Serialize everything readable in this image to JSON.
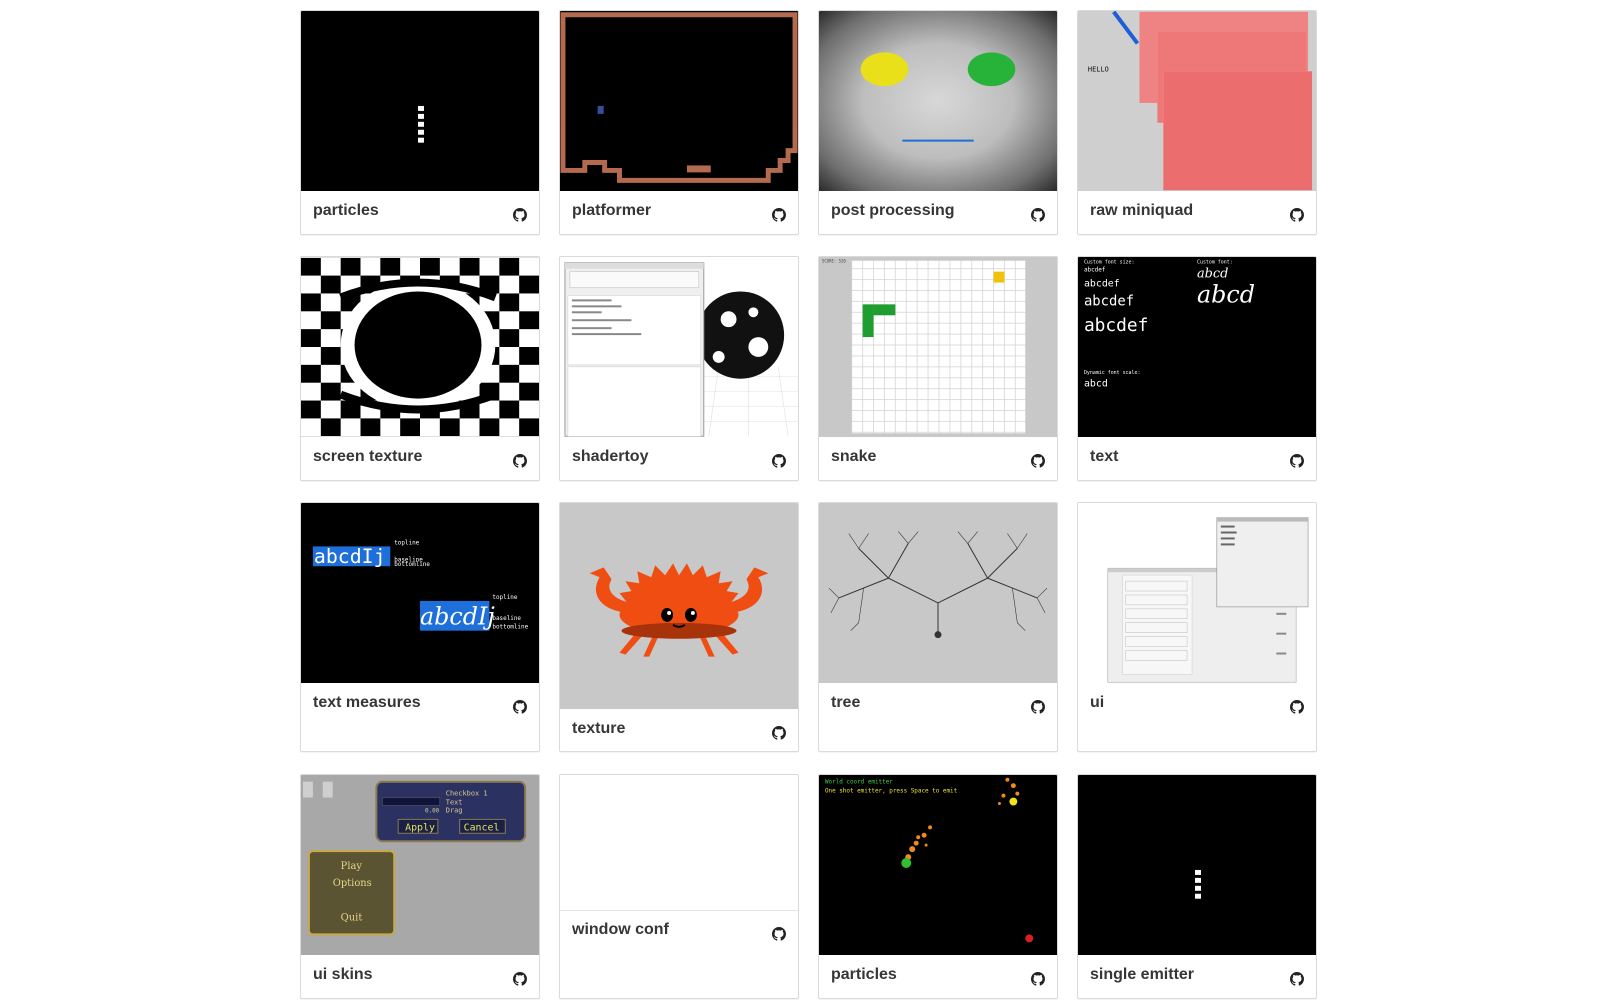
{
  "gallery": {
    "items": [
      {
        "label": "particles"
      },
      {
        "label": "platformer"
      },
      {
        "label": "post processing"
      },
      {
        "label": "raw miniquad"
      },
      {
        "label": "screen texture"
      },
      {
        "label": "shadertoy"
      },
      {
        "label": "snake"
      },
      {
        "label": "text"
      },
      {
        "label": "text measures"
      },
      {
        "label": "texture"
      },
      {
        "label": "tree"
      },
      {
        "label": "ui"
      },
      {
        "label": "ui skins"
      },
      {
        "label": "window conf"
      },
      {
        "label": "particles"
      },
      {
        "label": "single emitter"
      }
    ],
    "icon": "github-icon"
  },
  "thumbs": {
    "raw_miniquad_text": "HELLO",
    "text": {
      "custom_size": "Custom font size:",
      "custom_font": "Custom font:",
      "sample": "abcdef",
      "sample_short": "abcd",
      "dynamic": "Dynamic font scale:"
    },
    "text_measures": {
      "sample": "abcdIj",
      "topline": "topline",
      "baseline": "baseline",
      "bottomline": "bottomline"
    },
    "ui_skins": {
      "checkbox": "Checkbox 1",
      "text": "Text",
      "drag": "Drag",
      "value": "0.00",
      "apply": "Apply",
      "cancel": "Cancel",
      "play": "Play",
      "options": "Options",
      "quit": "Quit"
    },
    "particles2": {
      "line1": "World coord emitter",
      "line2": "One shot emitter, press Space to emit"
    },
    "snake_score": "SCORE: 520"
  }
}
